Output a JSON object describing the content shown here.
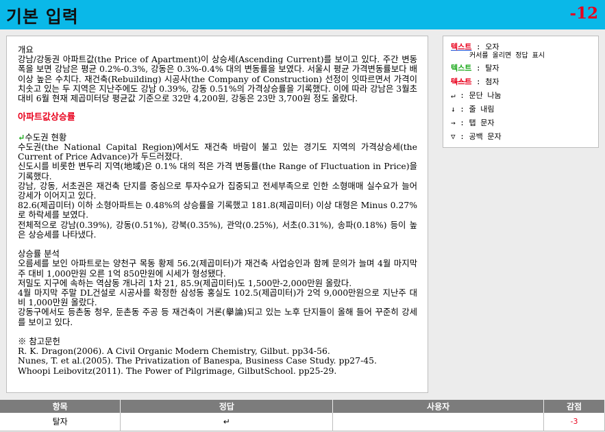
{
  "header": {
    "title": "기본 입력",
    "score": "-12"
  },
  "document": {
    "sections": [
      {
        "type": "text",
        "lines": [
          "개요",
          "강남/강동권 아파트값(the Price of Apartment)이 상승세(Ascending Current)를 보이고 있다. 주간 변동폭을 보면 강남은 평균 0.2%-0.3%, 강동은 0.3%-0.4% 대의 변동률을 보였다. 서울시 평균 가격변동률보다 배 이상 높은 수치다. 재건축(Rebuilding) 시공사(the Company of Construction) 선정이 잇따르면서 가격이 치솟고 있는 두 지역은 지난주에도 강남 0.39%, 강동 0.51%의 가격상승률을 기록했다. 이에 따라 강남은 3월초 대비 6월 현재 제곱미터당 평균값 기준으로 32만 4,200원, 강동은 23만 3,700원 정도 올랐다."
        ]
      },
      {
        "type": "gap"
      },
      {
        "type": "heading",
        "text": "아파트값상승률"
      },
      {
        "type": "gap"
      },
      {
        "type": "text",
        "lead": "↵",
        "lines": [
          "수도권 현황",
          "수도권(the National Capital Region)에서도 재건축 바람이 불고 있는 경기도 지역의 가격상승세(the Current of Price Advance)가 두드러졌다.",
          "신도시를 비롯한 변두리 지역(地域)은 0.1% 대의 적은 가격 변동률(the Range of Fluctuation in Price)을 기록했다.",
          "강남, 강동, 서초권은 재건축 단지를 중심으로 투자수요가 집중되고 전세부족으로 인한 소형매매 실수요가 늘어 강세가 이어지고 있다.",
          "82.6(제곱미터) 이하 소형아파트는 0.48%의 상승률을 기록했고 181.8(제곱미터) 이상 대형은 Minus 0.27%로 하락세를 보였다.",
          "전체적으로 강남(0.39%), 강동(0.51%), 강북(0.35%), 관악(0.25%), 서초(0.31%), 송파(0.18%) 등이 높은 상승세를 나타냈다."
        ]
      },
      {
        "type": "gap"
      },
      {
        "type": "text",
        "lines": [
          "상승률 분석",
          "오름세를 보인 아파트로는 양천구 목동 황제 56.2(제곱미터)가 재건축 사업승인과 함께 문의가 늘며 4월 마지막주 대비 1,000만원 오른 1억 850만원에 시세가 형성됐다.",
          "저밀도 지구에 속하는 역삼동 개나리 1차 21, 85.9(제곱미터)도 1,500만-2,000만원 올랐다.",
          "4월 마지막 주말 DL건설로 시공사를 확정한 삼성동 홍실도 102.5(제곱미터)가 2억 9,000만원으로 지난주 대비 1,000만원 올랐다.",
          "강동구에서도 등촌동 청우, 둔촌동 주공 등 재건축이 거론(擧論)되고 있는 노후 단지들이 올해 들어 꾸준히 강세를 보이고 있다."
        ]
      },
      {
        "type": "gap"
      },
      {
        "type": "text",
        "lines": [
          "※ 참고문헌",
          "R. K. Dragon(2006). A Civil Organic Modern Chemistry, Gilbut. pp34-56.",
          "Nunes, T. et al.(2005). The Privatization of Banespa, Business Case Study. pp27-45.",
          "Whoopi Leibovitz(2011). The Power of Pilgrimage, GilbutSchool. pp25-29."
        ]
      }
    ]
  },
  "legend": {
    "typo_label": "텍스트",
    "typo_desc": ": 오자",
    "typo_hint": "커서를 올리면 정답 표시",
    "omit_label": "텍스트",
    "omit_desc": ": 탈자",
    "extra_label": "텍스트",
    "extra_desc": ": 첨자",
    "para_desc": "↵ : 문단 나눔",
    "line_desc": "↓ : 줄 내림",
    "tab_desc": "→ : 탭 문자",
    "space_desc": "▽ : 공백 문자"
  },
  "results": {
    "headers": [
      "항목",
      "정답",
      "사용자",
      "감점"
    ],
    "rows": [
      {
        "item": "탈자",
        "answer": "↵",
        "user": "",
        "penalty": "-3"
      }
    ]
  }
}
